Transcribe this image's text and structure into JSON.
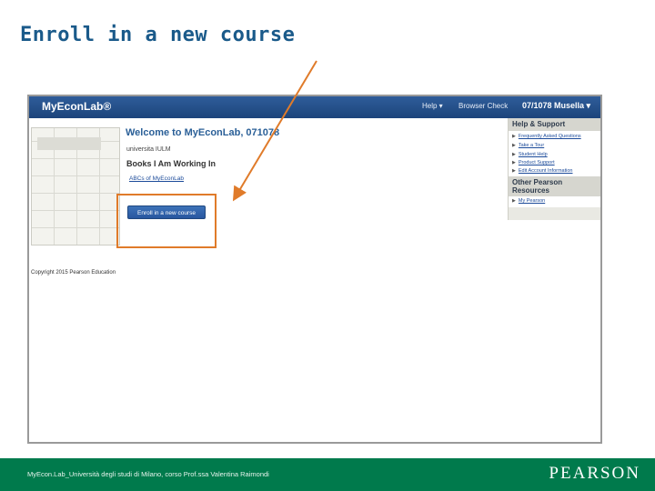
{
  "slide": {
    "title": "Enroll in a new course"
  },
  "app": {
    "logo": "MyEconLab®",
    "nav": {
      "help": "Help ▾",
      "browser_check": "Browser Check",
      "user": "07/1078 Musella ▾"
    },
    "welcome": "Welcome to MyEconLab, 071078",
    "university": "universita IULM",
    "books_heading": "Books I Am Working In",
    "abcs_link": "ABCs of MyEconLab",
    "enroll_button": "Enroll in a new course",
    "copyright": "Copyright 2015 Pearson Education",
    "help_panel": {
      "title": "Help & Support",
      "links": [
        "Frequently Asked Questions",
        "Take a Tour",
        "Student Help",
        "Product Support",
        "Edit Account Information"
      ]
    },
    "resources_panel": {
      "title_line1": "Other Pearson",
      "title_line2": "Resources",
      "links": [
        "My Pearson"
      ]
    }
  },
  "footer": {
    "text": "MyEcon.Lab_Università degli studi di Milano, corso Prof.ssa Valentina Raimondi",
    "brand": "PEARSON"
  },
  "colors": {
    "title": "#1a5a8a",
    "footer_bg": "#007a4c",
    "highlight": "#e07b2a",
    "topbar": "#1c447b"
  }
}
